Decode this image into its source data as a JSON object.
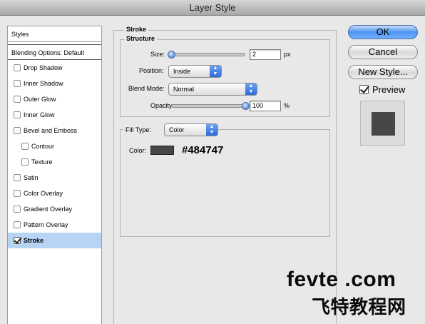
{
  "window": {
    "title": "Layer Style"
  },
  "sidebar": {
    "header": "Styles",
    "blending_options": "Blending Options: Default",
    "effects": [
      {
        "label": "Drop Shadow",
        "checked": false,
        "selected": false,
        "indent": false
      },
      {
        "label": "Inner Shadow",
        "checked": false,
        "selected": false,
        "indent": false
      },
      {
        "label": "Outer Glow",
        "checked": false,
        "selected": false,
        "indent": false
      },
      {
        "label": "Inner Glow",
        "checked": false,
        "selected": false,
        "indent": false
      },
      {
        "label": "Bevel and Emboss",
        "checked": false,
        "selected": false,
        "indent": false
      },
      {
        "label": "Contour",
        "checked": false,
        "selected": false,
        "indent": true
      },
      {
        "label": "Texture",
        "checked": false,
        "selected": false,
        "indent": true
      },
      {
        "label": "Satin",
        "checked": false,
        "selected": false,
        "indent": false
      },
      {
        "label": "Color Overlay",
        "checked": false,
        "selected": false,
        "indent": false
      },
      {
        "label": "Gradient Overlay",
        "checked": false,
        "selected": false,
        "indent": false
      },
      {
        "label": "Pattern Overlay",
        "checked": false,
        "selected": false,
        "indent": false
      },
      {
        "label": "Stroke",
        "checked": true,
        "selected": true,
        "indent": false
      }
    ]
  },
  "stroke": {
    "section_title": "Stroke",
    "structure": {
      "title": "Structure",
      "size_label": "Size:",
      "size_value": "2",
      "size_unit": "px",
      "size_slider_fraction": 0.0,
      "position_label": "Position:",
      "position_value": "Inside",
      "blend_mode_label": "Blend Mode:",
      "blend_mode_value": "Normal",
      "opacity_label": "Opacity:",
      "opacity_value": "100",
      "opacity_unit": "%",
      "opacity_slider_fraction": 1.0
    },
    "fill": {
      "fill_type_label": "Fill Type:",
      "fill_type_value": "Color",
      "color_label": "Color:",
      "color_hex": "#484747"
    }
  },
  "buttons": {
    "ok": "OK",
    "cancel": "Cancel",
    "new_style": "New Style..."
  },
  "preview": {
    "label": "Preview",
    "checked": true,
    "color": "#484747"
  },
  "watermark": {
    "site": "fevte .com",
    "chinese": "飞特教程网"
  },
  "colors": {
    "selection": "#b7d4f5",
    "primary_button": "#4d94f0",
    "stroke_color": "#484747"
  }
}
